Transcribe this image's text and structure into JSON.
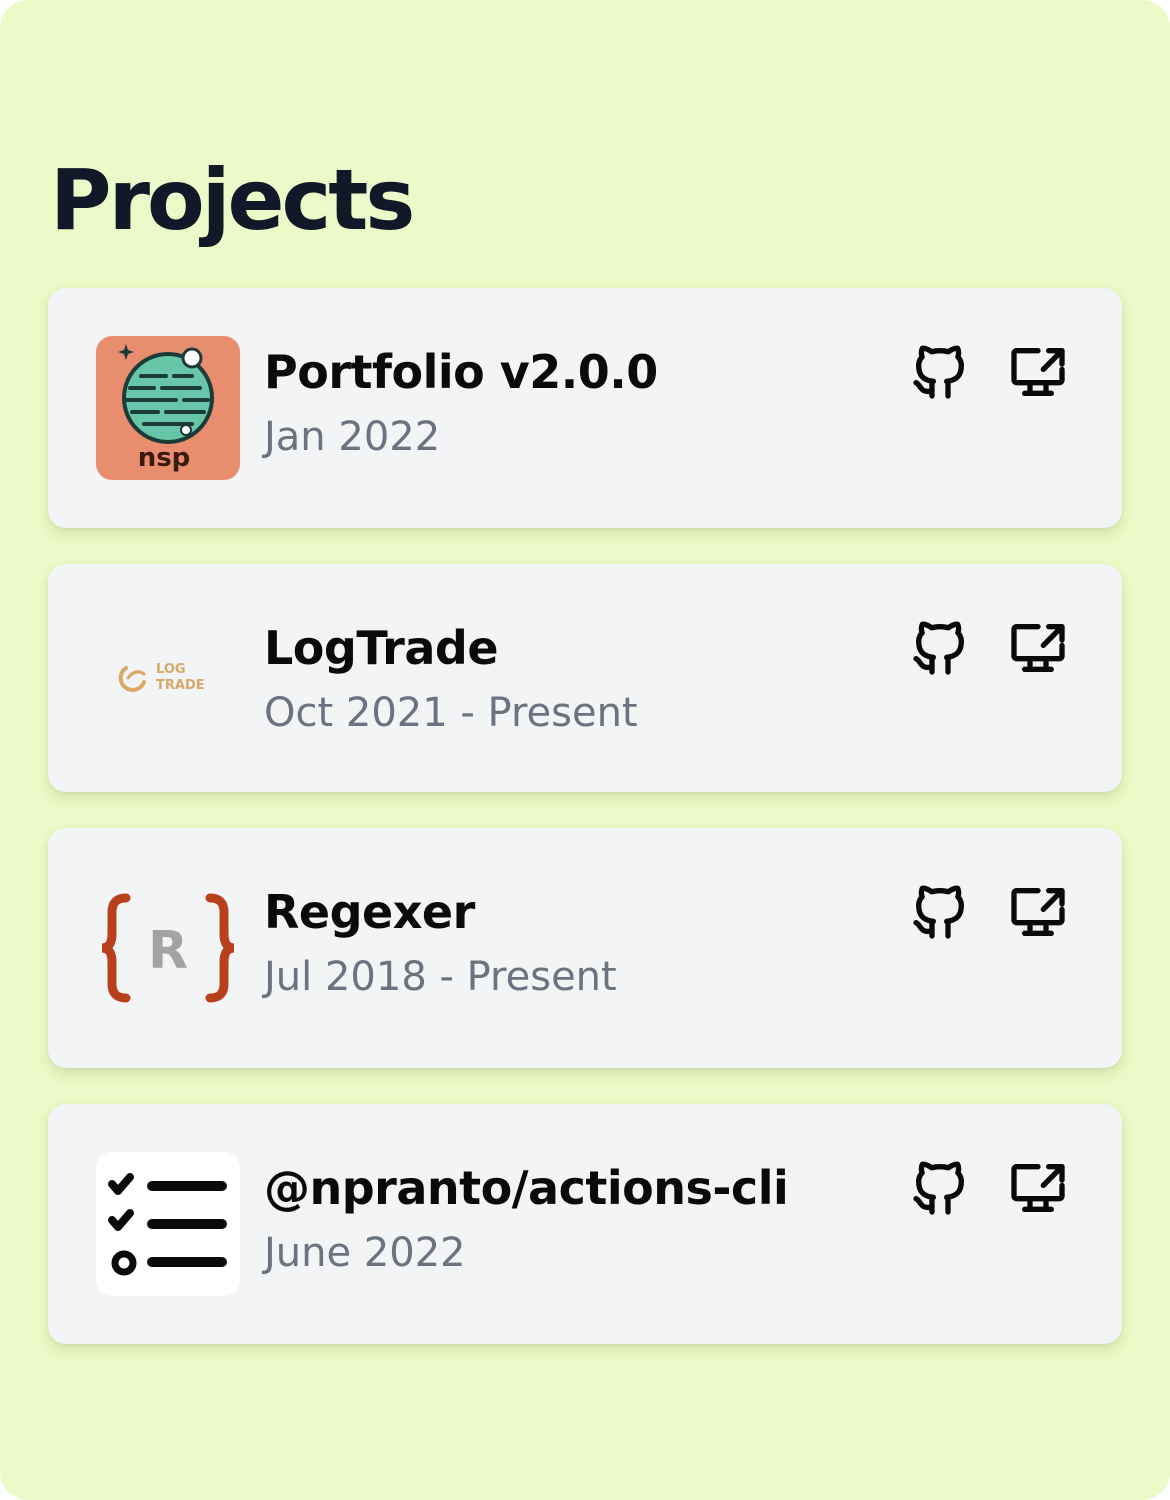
{
  "section": {
    "title": "Projects"
  },
  "colors": {
    "background": "#ecf9c8",
    "card": "#f3f4f6",
    "title_text": "#111827",
    "date_text": "#6b7280"
  },
  "projects": [
    {
      "name": "Portfolio v2.0.0",
      "date": "Jan 2022",
      "logo_icon": "nsp-globe-logo",
      "logo_text": "nsp",
      "links": [
        "github-icon",
        "external-site-icon"
      ]
    },
    {
      "name": "LogTrade",
      "date": "Oct 2021 - Present",
      "logo_icon": "logtrade-logo",
      "logo_text": "LOG TRADE",
      "links": [
        "github-icon",
        "external-site-icon"
      ]
    },
    {
      "name": "Regexer",
      "date": "Jul 2018 - Present",
      "logo_icon": "regexer-braces-logo",
      "logo_text": "R",
      "links": [
        "github-icon",
        "external-site-icon"
      ]
    },
    {
      "name": "@npranto/actions-cli",
      "date": "June 2022",
      "logo_icon": "checklist-logo",
      "links": [
        "github-icon",
        "external-site-icon"
      ]
    }
  ]
}
